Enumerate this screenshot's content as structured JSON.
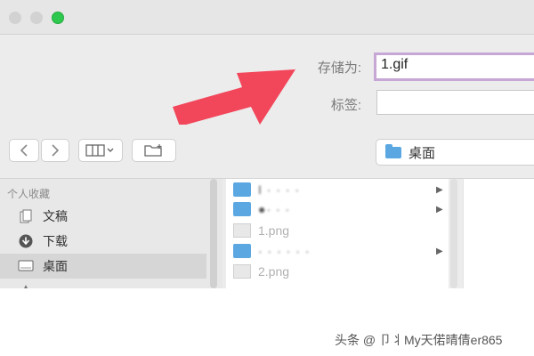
{
  "dialog": {
    "save_as_label": "存储为:",
    "save_as_value": "1.gif",
    "tags_label": "标签:",
    "tags_value": "",
    "location": "桌面"
  },
  "toolbar": {
    "back_icon": "chevron-left-icon",
    "forward_icon": "chevron-right-icon",
    "view_icon": "column-view-icon",
    "new_folder_icon": "new-folder-icon"
  },
  "sidebar": {
    "section_title": "个人收藏",
    "items": [
      {
        "label": "文稿",
        "icon": "documents-icon"
      },
      {
        "label": "下载",
        "icon": "downloads-icon"
      },
      {
        "label": "桌面",
        "icon": "desktop-icon",
        "selected": true
      }
    ]
  },
  "files": [
    {
      "name": "I  ·  ·  ·  ·",
      "kind": "folder",
      "chevron": true
    },
    {
      "name": "●·  ·  ·",
      "kind": "folder",
      "chevron": true
    },
    {
      "name": "1.png",
      "kind": "image",
      "dim": true
    },
    {
      "name": "·  ·  ·  ·  ·  ·",
      "kind": "folder",
      "chevron": true
    },
    {
      "name": "2.png",
      "kind": "image",
      "dim": true
    }
  ],
  "watermark": "头条 @ 卩丬My天偌晴倩er865",
  "colors": {
    "focus_ring": "#c6a7d6",
    "arrow": "#f2465a",
    "folder": "#5aa7e2",
    "zoom_button": "#2dc84d"
  }
}
